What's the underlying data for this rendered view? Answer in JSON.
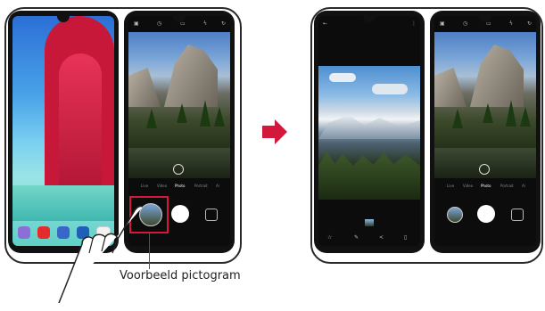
{
  "callout": {
    "label": "Voorbeeld pictogram"
  },
  "camera": {
    "modes": [
      "Live",
      "Video",
      "Photo",
      "Portrait",
      "Ai"
    ],
    "active_mode": "Photo"
  },
  "colors": {
    "accent": "#d2193c",
    "frame": "#2a2a2a"
  },
  "icons": {
    "home_dock": [
      "apps-icon",
      "youtube-icon",
      "game-icon",
      "app-icon",
      "app-drawer-icon"
    ],
    "gallery_toolbar": [
      "star-icon",
      "edit-icon",
      "share-icon",
      "delete-icon"
    ]
  }
}
